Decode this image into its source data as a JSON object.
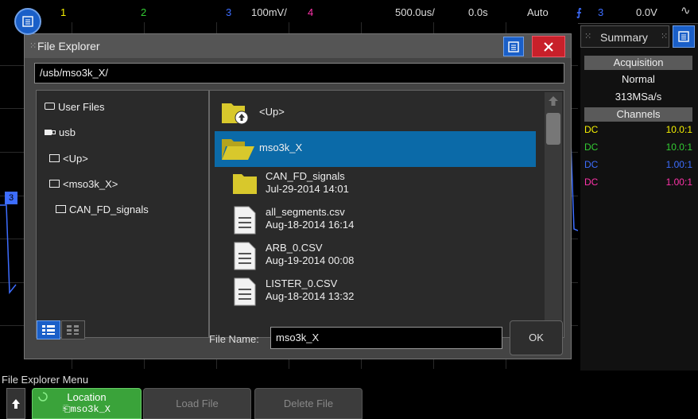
{
  "topbar": {
    "ch1": "1",
    "ch2": "2",
    "ch3": "3",
    "scale": "100mV/",
    "ch4": "4",
    "timebase": "500.0us/",
    "delay": "0.0s",
    "trigger_mode": "Auto",
    "trig_src": "3",
    "trig_level": "0.0V"
  },
  "colors": {
    "ch1": "#f5f000",
    "ch2": "#33cc33",
    "ch3": "#3d6dff",
    "ch4": "#ff33aa",
    "accent": "#1a5fc8",
    "selected": "#0b6aa8",
    "softkey_active": "#3aa33a"
  },
  "right_panel": {
    "tab_label": "Summary",
    "acquisition_header": "Acquisition",
    "acq_mode": "Normal",
    "sample_rate": "313MSa/s",
    "channels_header": "Channels",
    "channels": [
      {
        "coupling": "DC",
        "ratio": "10.0:1"
      },
      {
        "coupling": "DC",
        "ratio": "10.0:1"
      },
      {
        "coupling": "DC",
        "ratio": "1.00:1"
      },
      {
        "coupling": "DC",
        "ratio": "1.00:1"
      }
    ]
  },
  "dialog": {
    "title": "File Explorer",
    "path": "/usb/mso3k_X/",
    "tree": [
      {
        "label": "User Files",
        "icon": "drive-icon"
      },
      {
        "label": "usb",
        "icon": "usb-icon"
      },
      {
        "label": "<Up>",
        "icon": "folder-up-icon"
      },
      {
        "label": "<mso3k_X>",
        "icon": "folder-open-icon"
      },
      {
        "label": "CAN_FD_signals",
        "icon": "folder-icon"
      }
    ],
    "files": [
      {
        "name": "<Up>",
        "date": "",
        "type": "folder-up"
      },
      {
        "name": "mso3k_X",
        "date": "",
        "type": "folder-open"
      },
      {
        "name": "CAN_FD_signals",
        "date": "Jul-29-2014 14:01",
        "type": "folder"
      },
      {
        "name": "all_segments.csv",
        "date": "Aug-18-2014 16:14",
        "type": "file"
      },
      {
        "name": "ARB_0.CSV",
        "date": "Aug-19-2014 00:08",
        "type": "file"
      },
      {
        "name": "LISTER_0.CSV",
        "date": "Aug-18-2014 13:32",
        "type": "file"
      }
    ],
    "file_name_label": "File Name:",
    "file_name_value": "mso3k_X",
    "ok_label": "OK"
  },
  "softkeys": {
    "menu_label": "File Explorer Menu",
    "location_label": "Location",
    "location_value": "mso3k_X",
    "load_file": "Load File",
    "delete_file": "Delete File"
  }
}
